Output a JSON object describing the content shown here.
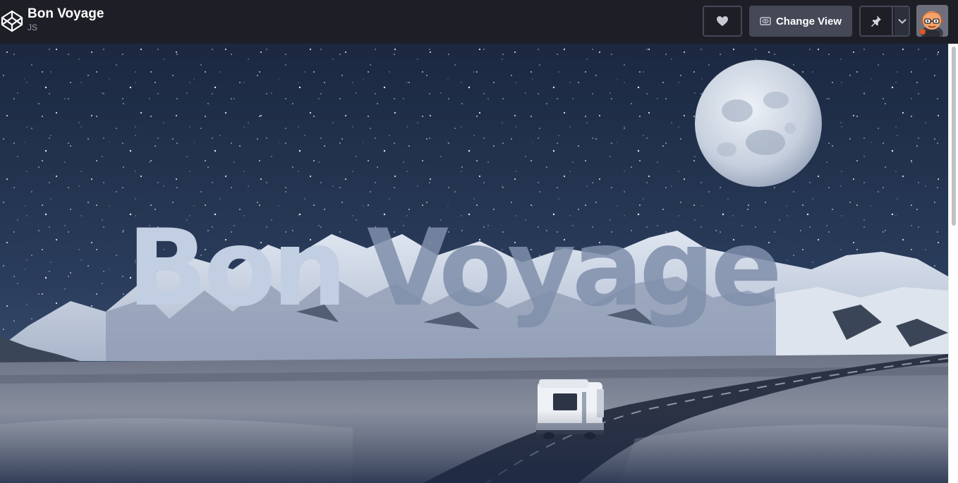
{
  "header": {
    "title": "Bon Voyage",
    "subtitle": "JS",
    "logo_icon": "codepen-logo-icon",
    "heart_icon": "heart-icon",
    "change_view_label": "Change View",
    "change_view_icon": "eye-icon",
    "pin_icon": "pin-icon",
    "dropdown_icon": "chevron-down-icon",
    "avatar": "user-avatar"
  },
  "preview": {
    "heading_word1": "Bon",
    "heading_word2": "Voyage",
    "scene": "night sky with moon, snowy mountains, grassland and road with camper"
  },
  "colors": {
    "topbar": "#1e1f26",
    "button": "#444857",
    "sky_top": "#1b2a44",
    "sky_bottom": "#3a4f72",
    "heading_light": "#c2cfe2",
    "heading_dark": "#7a8aa6"
  }
}
